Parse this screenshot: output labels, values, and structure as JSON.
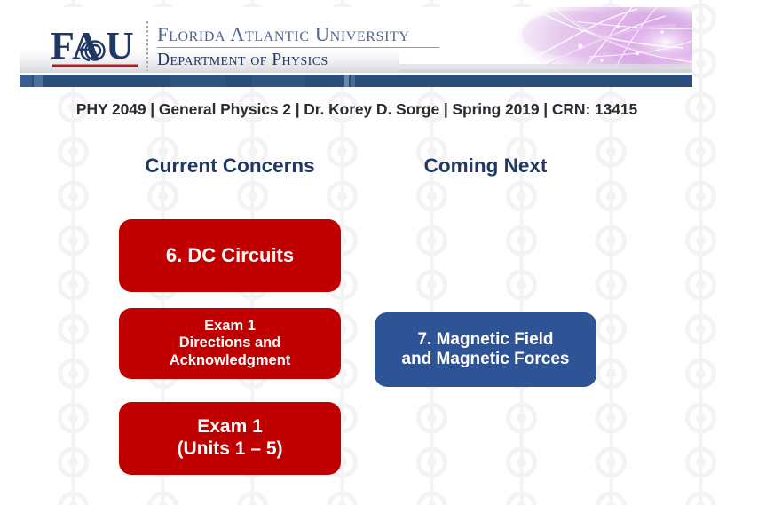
{
  "banner": {
    "logo_text": "FAU",
    "logo_name": "fau-owl-logo",
    "university_name": "Florida Atlantic University",
    "department_name": "Department of Physics",
    "artwork_name": "abstract-purple-network-graphic",
    "accent_red": "#ae1c28",
    "bar_blue": "#2b4d7e"
  },
  "course_info": "PHY 2049 | General Physics 2 | Dr. Korey D. Sorge | Spring 2019 | CRN: 13415",
  "columns": [
    {
      "heading": "Current Concerns"
    },
    {
      "heading": "Coming Next"
    }
  ],
  "current_concerns": [
    {
      "id": "dc-circuits",
      "color": "#c00000",
      "lines": [
        "6. DC Circuits"
      ]
    },
    {
      "id": "exam1-directions",
      "color": "#c00000",
      "lines": [
        "Exam 1",
        "Directions and",
        "Acknowledgment"
      ]
    },
    {
      "id": "exam1-units",
      "color": "#c00000",
      "lines": [
        "Exam 1",
        "(Units 1 – 5)"
      ]
    }
  ],
  "coming_next": [
    {
      "id": "magnetic-field",
      "color": "#2f5496",
      "lines": [
        "7. Magnetic Field",
        "and Magnetic Forces"
      ]
    }
  ],
  "background": {
    "watermark_name": "circle-node-chain-watermark",
    "watermark_color": "#f4f4f4"
  }
}
